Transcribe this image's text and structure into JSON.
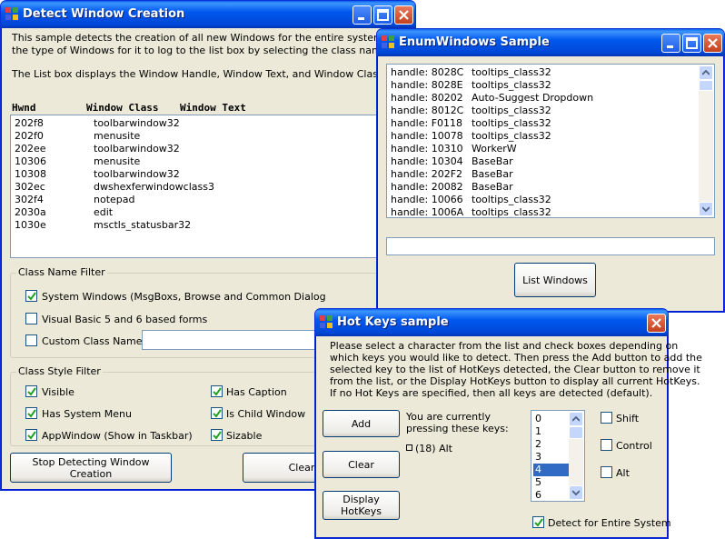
{
  "detect": {
    "title": "Detect Window Creation",
    "desc1": "This sample detects the creation of all new Windows for the entire system. You can",
    "desc2": "the type of Windows for it to log to the list box by selecting the class name or styles",
    "desc3": "The List box displays the Window Handle, Window Text, and Window Class Name",
    "col_hwnd": "Hwnd",
    "col_class": "Window Class",
    "col_text": "Window Text",
    "rows": [
      {
        "hwnd": "202f8",
        "cls": "toolbarwindow32"
      },
      {
        "hwnd": "202f0",
        "cls": "menusite"
      },
      {
        "hwnd": "202ee",
        "cls": "toolbarwindow32"
      },
      {
        "hwnd": "10306",
        "cls": "menusite"
      },
      {
        "hwnd": "10308",
        "cls": "toolbarwindow32"
      },
      {
        "hwnd": "302ec",
        "cls": "dwshexferwindowclass3"
      },
      {
        "hwnd": "302f4",
        "cls": "notepad"
      },
      {
        "hwnd": "2030a",
        "cls": "edit"
      },
      {
        "hwnd": "1030e",
        "cls": "msctls_statusbar32"
      }
    ],
    "class_filter_title": "Class Name Filter",
    "cb_system": "System Windows (MsgBoxs, Browse and Common Dialog",
    "cb_vb": "Visual Basic 5 and 6 based forms",
    "cb_custom": "Custom Class Name",
    "style_filter_title": "Class Style Filter",
    "cb_visible": "Visible",
    "cb_sysmenu": "Has System Menu",
    "cb_appwindow": "AppWindow (Show in Taskbar)",
    "cb_caption": "Has Caption",
    "cb_child": "Is Child Window",
    "cb_sizable": "Sizable",
    "btn_stop": "Stop Detecting Window Creation",
    "btn_clear": "Clear"
  },
  "enum": {
    "title": "EnumWindows Sample",
    "rows": [
      {
        "h": "handle: 8028C",
        "t": "tooltips_class32"
      },
      {
        "h": "handle: 8028E",
        "t": "tooltips_class32"
      },
      {
        "h": "handle: 80202",
        "t": "Auto-Suggest Dropdown"
      },
      {
        "h": "handle: 8012C",
        "t": "tooltips_class32"
      },
      {
        "h": "handle: F0118",
        "t": "tooltips_class32"
      },
      {
        "h": "handle: 10078",
        "t": "tooltips_class32"
      },
      {
        "h": "handle: 10310",
        "t": "WorkerW"
      },
      {
        "h": "handle: 10304",
        "t": "BaseBar"
      },
      {
        "h": "handle: 202F2",
        "t": "BaseBar"
      },
      {
        "h": "handle: 20082",
        "t": "BaseBar"
      },
      {
        "h": "handle: 10066",
        "t": "tooltips_class32"
      },
      {
        "h": "handle: 1006A",
        "t": "tooltips_class32"
      }
    ],
    "btn_list": "List Windows"
  },
  "hotkeys": {
    "title": "Hot Keys sample",
    "instr1": "Please select a character from the list and check boxes depending on",
    "instr2": "which keys you would like to detect.  Then press the Add button to add the",
    "instr3": "selected key to the list of HotKeys detected, the Clear button to remove it",
    "instr4": "from the list, or the Display HotKeys button to display all current HotKeys.",
    "instr5": "If no Hot Keys are specified, then all keys are detected (default).",
    "btn_add": "Add",
    "btn_clear": "Clear",
    "btn_display1": "Display",
    "btn_display2": "HotKeys",
    "pressing1": "You are currently",
    "pressing2": "pressing these keys:",
    "key_entry": "(18) Alt",
    "chars": [
      "0",
      "1",
      "2",
      "3",
      "4",
      "5",
      "6"
    ],
    "selected_char": "4",
    "cb_shift": "Shift",
    "cb_control": "Control",
    "cb_alt": "Alt",
    "cb_entire": "Detect for Entire System"
  }
}
